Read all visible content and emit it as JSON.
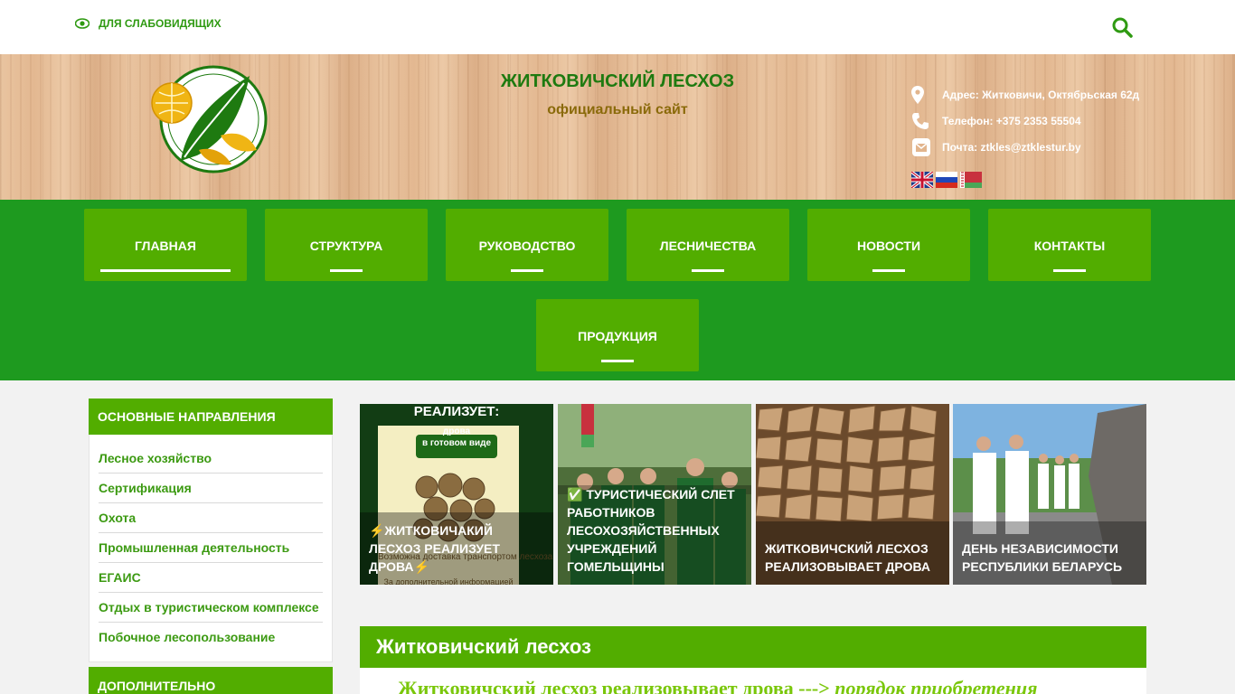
{
  "topbar": {
    "vision_label": "ДЛЯ СЛАБОВИДЯЩИХ",
    "icons": {
      "vision": "eye-icon",
      "search": "search-icon"
    }
  },
  "header": {
    "title": "ЖИТКОВИЧСКИЙ ЛЕСХОЗ",
    "subtitle": "официальный сайт",
    "address": "Адрес: Житковичи, Октябрьская 62д",
    "phone": "Телефон: +375 2353 55504",
    "email": "Почта: ztkles@ztklestur.by",
    "languages": [
      "English",
      "Русский",
      "Беларуская"
    ]
  },
  "nav": {
    "items": [
      {
        "label": "ГЛАВНАЯ",
        "active": true
      },
      {
        "label": "СТРУКТУРА"
      },
      {
        "label": "РУКОВОДСТВО"
      },
      {
        "label": "ЛЕСНИЧЕСТВА"
      },
      {
        "label": "НОВОСТИ"
      },
      {
        "label": "КОНТАКТЫ"
      },
      {
        "label": "ПРОДУКЦИЯ"
      }
    ]
  },
  "sidebar": {
    "heading": "ОСНОВНЫЕ НАПРАВЛЕНИЯ",
    "items": [
      "Лесное хозяйство",
      "Сертификация",
      "Охота",
      "Промышленная деятельность",
      "ЕГАИС",
      "Отдых в туристическом комплексе",
      "Побочное лесопользование"
    ],
    "heading2": "ДОПОЛНИТЕЛЬНО"
  },
  "news": {
    "items": [
      {
        "caption": "⚡ЖИТКОВИЧАКИЙ ЛЕСХОЗ РЕАЛИЗУЕТ ДРОВА⚡",
        "poster_title": "РЕАЛИЗУЕТ:",
        "poster_sub": "дрова\nв готовом виде",
        "poster_note1": "Возможна доставка транспортом лесхоза",
        "poster_note2": "За дополнительной информацией"
      },
      {
        "caption": "✅ ТУРИСТИЧЕСКИЙ СЛЕТ РАБОТНИКОВ ЛЕСОХОЗЯЙСТВЕННЫХ УЧРЕЖДЕНИЙ ГОМЕЛЬЩИНЫ"
      },
      {
        "caption": "ЖИТКОВИЧСКИЙ ЛЕСХОЗ РЕАЛИЗОВЫВАЕТ ДРОВА"
      },
      {
        "caption": "ДЕНЬ НЕЗАВИСИМОСТИ РЕСПУБЛИКИ БЕЛАРУСЬ"
      }
    ]
  },
  "main": {
    "heading": "Житковичский лесхоз",
    "announcement": "Житковичский лесхоз реализовывает дрова",
    "arrow": " --->",
    "link_text": "порядок приобретения"
  },
  "colors": {
    "brand_green": "#1e9a1f",
    "nav_tile_green": "#52ad00",
    "link_green": "#3c9a12",
    "title_green": "#1e7a10",
    "subtitle_gold": "#8a6a0a"
  }
}
